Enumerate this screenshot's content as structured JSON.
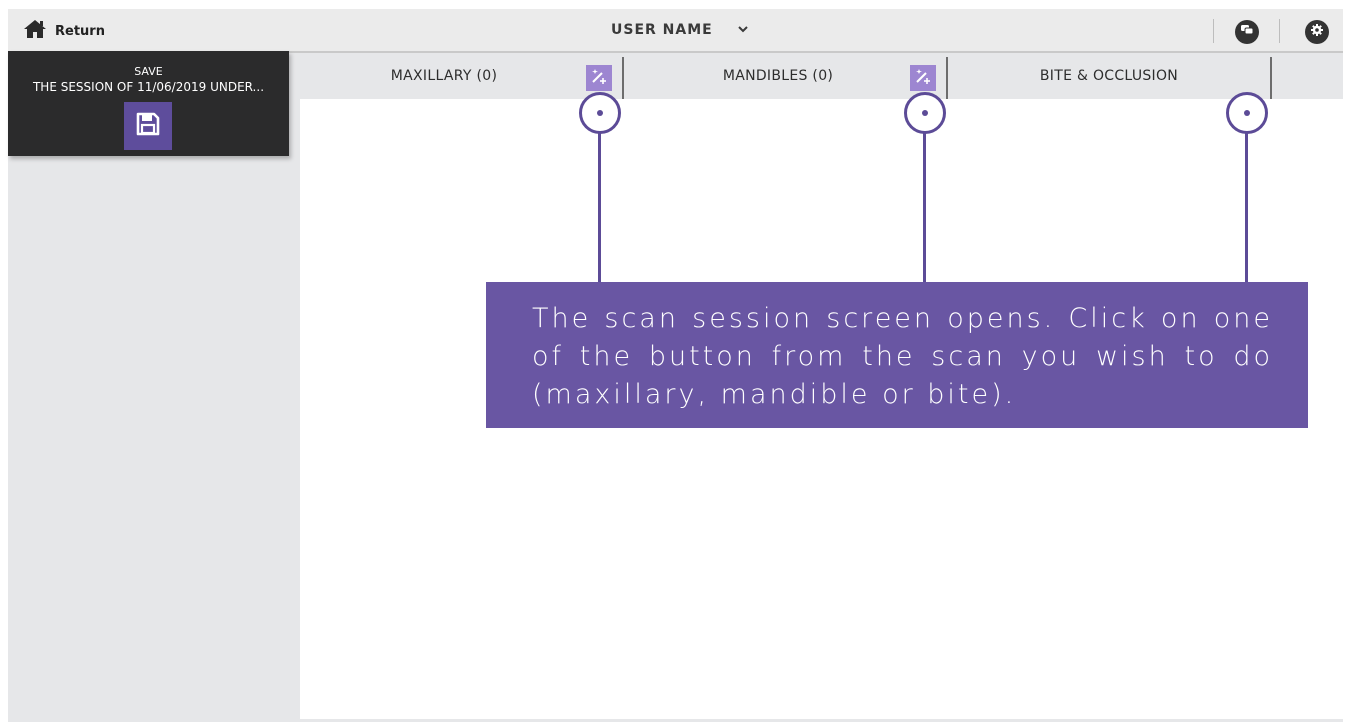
{
  "topbar": {
    "return_label": "Return",
    "return_icon": "home-icon",
    "user_name": "USER NAME",
    "user_menu_icon": "chevron-down-icon",
    "right_icons": [
      "chat-icon",
      "gear-icon"
    ]
  },
  "save_panel": {
    "save_label": "SAVE",
    "session_label": "THE SESSION OF 11/06/2019 UNDER...",
    "save_icon": "floppy-disk-icon"
  },
  "tabs": [
    {
      "label": "MAXILLARY (0)",
      "has_add_button": true
    },
    {
      "label": "MANDIBLES (0)",
      "has_add_button": true
    },
    {
      "label": "BITE & OCCLUSION",
      "has_add_button": false
    }
  ],
  "callout": {
    "text": "The scan session screen opens. Click on one of the button from the scan you wish to do (maxillary, mandible or bite)."
  },
  "colors": {
    "accent": "#6956a3",
    "accent_dark": "#5c4b97",
    "add_button": "#9d86d1",
    "save_panel_bg": "#2b2b2c",
    "sidebar_bg": "#e6e7e9"
  }
}
